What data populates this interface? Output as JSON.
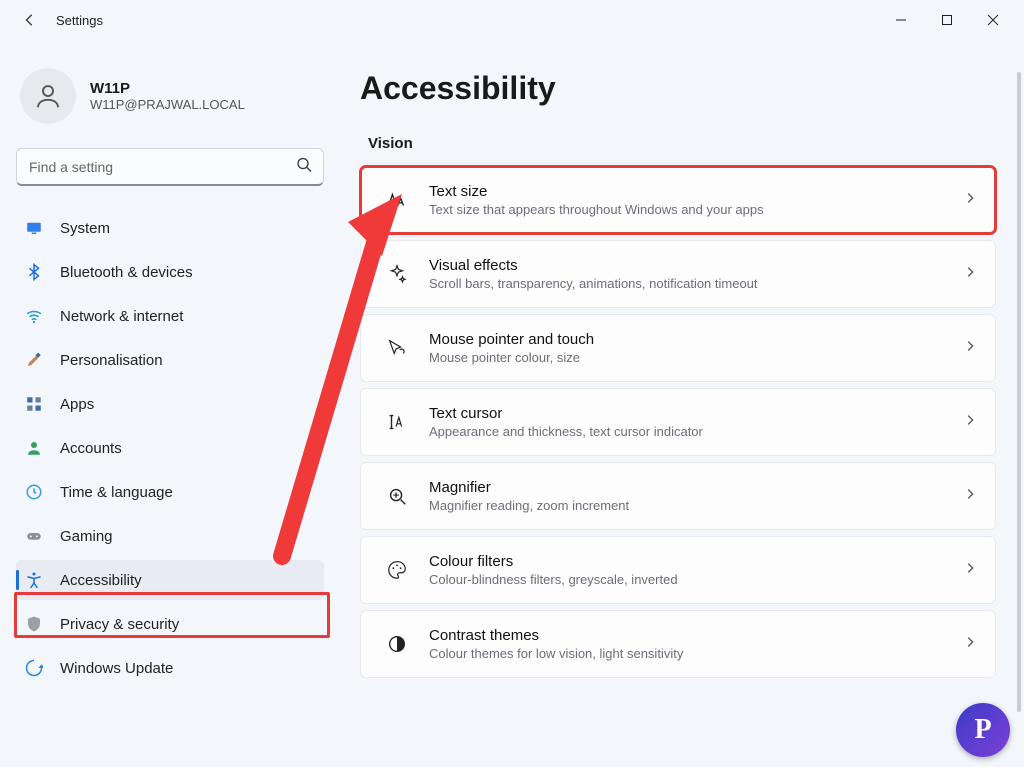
{
  "window": {
    "title": "Settings"
  },
  "user": {
    "name": "W11P",
    "email": "W11P@PRAJWAL.LOCAL"
  },
  "search": {
    "placeholder": "Find a setting"
  },
  "sidebar": {
    "items": [
      {
        "icon": "display",
        "label": "System",
        "color": "#2f7fe6"
      },
      {
        "icon": "bluetooth",
        "label": "Bluetooth & devices",
        "color": "#1a73e8"
      },
      {
        "icon": "wifi",
        "label": "Network & internet",
        "color": "#1e9bd7"
      },
      {
        "icon": "brush",
        "label": "Personalisation",
        "color": "#3a6ea5"
      },
      {
        "icon": "apps",
        "label": "Apps",
        "color": "#3a6ea5"
      },
      {
        "icon": "account",
        "label": "Accounts",
        "color": "#36a064"
      },
      {
        "icon": "time",
        "label": "Time & language",
        "color": "#3a9ed9"
      },
      {
        "icon": "game",
        "label": "Gaming",
        "color": "#7a7f87"
      },
      {
        "icon": "accessibility",
        "label": "Accessibility",
        "color": "#1a6fd8",
        "active": true
      },
      {
        "icon": "shield",
        "label": "Privacy & security",
        "color": "#9aa0a8"
      },
      {
        "icon": "update",
        "label": "Windows Update",
        "color": "#1e88e5"
      }
    ]
  },
  "page": {
    "title": "Accessibility",
    "section": "Vision",
    "options": [
      {
        "icon": "textsize",
        "title": "Text size",
        "sub": "Text size that appears throughout Windows and your apps",
        "highlight": true
      },
      {
        "icon": "sparkle",
        "title": "Visual effects",
        "sub": "Scroll bars, transparency, animations, notification timeout"
      },
      {
        "icon": "pointer",
        "title": "Mouse pointer and touch",
        "sub": "Mouse pointer colour, size"
      },
      {
        "icon": "textcursor",
        "title": "Text cursor",
        "sub": "Appearance and thickness, text cursor indicator"
      },
      {
        "icon": "magnifier",
        "title": "Magnifier",
        "sub": "Magnifier reading, zoom increment"
      },
      {
        "icon": "palette",
        "title": "Colour filters",
        "sub": "Colour-blindness filters, greyscale, inverted"
      },
      {
        "icon": "contrast",
        "title": "Contrast themes",
        "sub": "Colour themes for low vision, light sensitivity"
      }
    ]
  },
  "watermark": "P"
}
